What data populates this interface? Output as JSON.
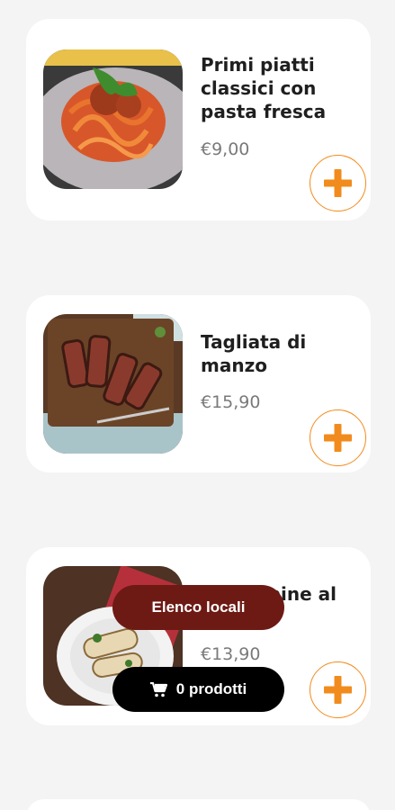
{
  "products": [
    {
      "name": "Primi piatti classici con pasta fresca",
      "price": "€9,00",
      "image": "pasta-tagliatelle-bolognese"
    },
    {
      "name": "Tagliata di manzo",
      "price": "€15,90",
      "image": "sliced-beef-steak"
    },
    {
      "name": "Scaloppine al ...a di",
      "price": "€13,90",
      "image": "chicken-rolls-plate"
    }
  ],
  "add_icon": "plus-icon",
  "cart_icon": "cart-icon",
  "floating": {
    "locali_label": "Elenco locali",
    "cart_label": "0 prodotti"
  },
  "colors": {
    "accent": "#f28b1d",
    "locali_pill": "#6d1a14",
    "cart_pill": "#000000",
    "background": "#f4f4f4"
  }
}
